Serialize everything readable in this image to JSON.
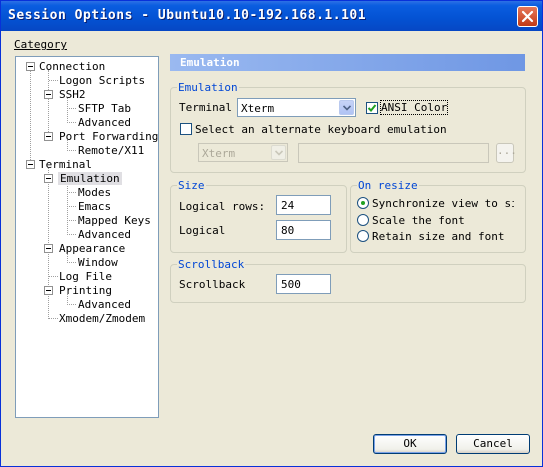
{
  "window": {
    "title": "Session Options - Ubuntu10.10-192.168.1.101"
  },
  "category_label": "Category",
  "tree": {
    "connection": "Connection",
    "logon_scripts": "Logon Scripts",
    "ssh2": "SSH2",
    "sftp_tab": "SFTP Tab",
    "advanced_ssh2": "Advanced",
    "port_forwarding": "Port Forwarding",
    "remote_x11": "Remote/X11",
    "terminal": "Terminal",
    "emulation": "Emulation",
    "modes": "Modes",
    "emacs": "Emacs",
    "mapped_keys": "Mapped Keys",
    "advanced_emulation": "Advanced",
    "appearance": "Appearance",
    "window": "Window",
    "log_file": "Log File",
    "printing": "Printing",
    "advanced_printing": "Advanced",
    "xmodem_zmodem": "Xmodem/Zmodem"
  },
  "panel_title": "Emulation",
  "emulation_group": {
    "label": "Emulation",
    "terminal_label": "Terminal",
    "terminal_value": "Xterm",
    "ansi_color_label": "ANSI Color",
    "ansi_color_checked": true,
    "alternate_label": "Select an alternate keyboard emulation",
    "alternate_checked": false,
    "alternate_value": "Xterm",
    "browse_label": "..."
  },
  "size_group": {
    "label": "Size",
    "rows_label": "Logical rows:",
    "rows_value": "24",
    "cols_label": "Logical",
    "cols_value": "80"
  },
  "resize_group": {
    "label": "On resize",
    "options": [
      "Synchronize view to siz",
      "Scale the font",
      "Retain size and font"
    ],
    "selected": "Synchronize view to siz"
  },
  "scrollback_group": {
    "label": "Scrollback",
    "scrollback_label": "Scrollback",
    "scrollback_value": "500"
  },
  "buttons": {
    "ok": "OK",
    "cancel": "Cancel"
  },
  "colors": {
    "title_bar": "#0453d4",
    "group_label": "#0046d5",
    "banner": "#6f97e4",
    "close_button": "#c23a16"
  }
}
